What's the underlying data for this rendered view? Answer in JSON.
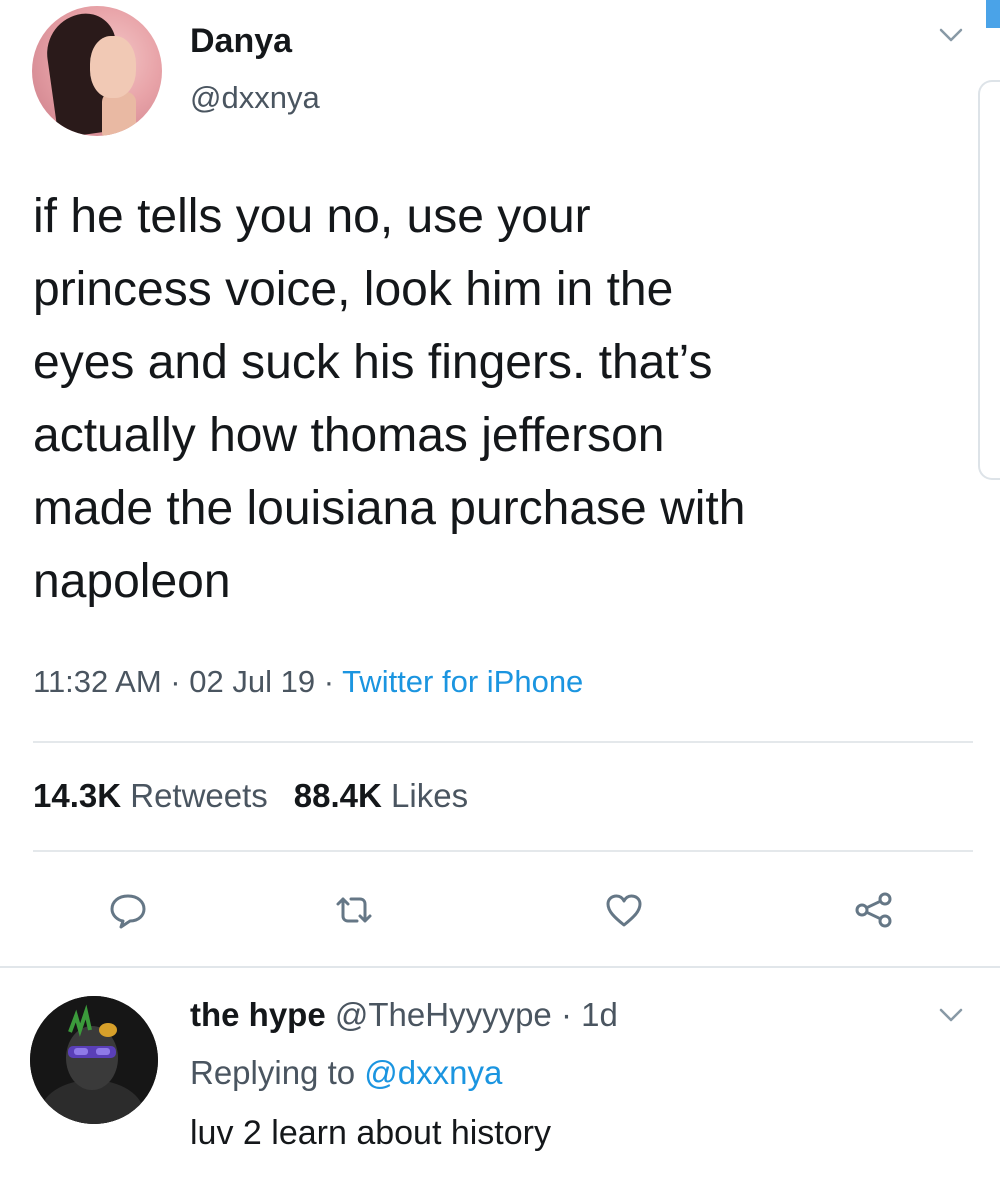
{
  "tweet": {
    "author": {
      "name": "Danya",
      "handle": "@dxxnya"
    },
    "text": "if he tells you no, use your\nprincess voice, look him in the\neyes and suck his fingers. that’s\nactually how thomas jefferson\nmade the louisiana purchase with\nnapoleon",
    "time": "11:32 AM",
    "date": "02 Jul 19",
    "separator": " · ",
    "source": "Twitter for iPhone",
    "retweets": {
      "count": "14.3K",
      "label": "Retweets"
    },
    "likes": {
      "count": "88.4K",
      "label": "Likes"
    }
  },
  "reply": {
    "name": "the hype",
    "handle": "@TheHyyyype",
    "age": "1d",
    "replying_prefix": "Replying to",
    "replying_to": "@dxxnya",
    "text": "luv 2 learn about history"
  },
  "colors": {
    "text": "#14171a",
    "secondary": "#4a5560",
    "link": "#1b95e0",
    "divider": "#e4e8eb"
  },
  "icons": {
    "menu": "chevron-down-icon",
    "reply": "comment-icon",
    "retweet": "retweet-icon",
    "like": "heart-icon",
    "share": "share-icon"
  }
}
